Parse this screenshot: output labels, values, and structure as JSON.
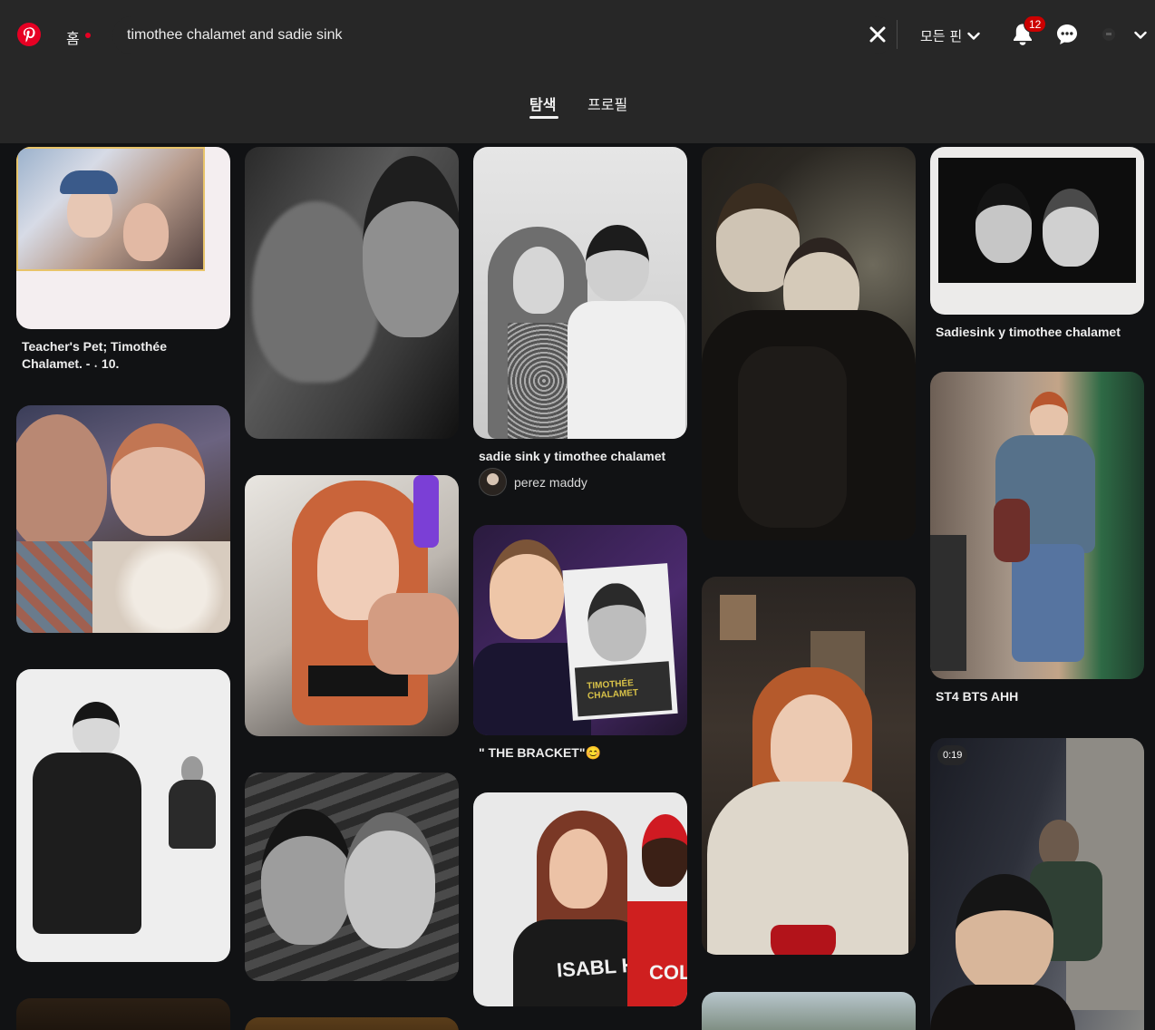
{
  "topbar": {
    "home_label": "홈",
    "search_value": "timothee chalamet and sadie sink",
    "filter_label": "모든 핀",
    "notification_count": "12",
    "accent_color": "#e60023"
  },
  "tabs": [
    {
      "label": "탐색",
      "active": true
    },
    {
      "label": "프로필",
      "active": false
    }
  ],
  "pins": {
    "p1": {
      "caption": "Teacher's Pet; Timothée\nChalamet. - ˖ 10."
    },
    "p3": {
      "caption": "sadie sink y timothee chalamet",
      "owner": "perez maddy"
    },
    "p5": {
      "caption": "Sadiesink y timothee chalamet"
    },
    "p9": {
      "caption": "\" THE BRACKET\"😊",
      "photo_text": "TIMOTHÉE\nCHALAMET"
    },
    "p10": {
      "caption": "ST4 BTS AHH"
    },
    "p15": {
      "duration": "0:19"
    },
    "p13": {
      "shirt_text": "ISABL HA",
      "shirt_text_2": "COL"
    }
  }
}
